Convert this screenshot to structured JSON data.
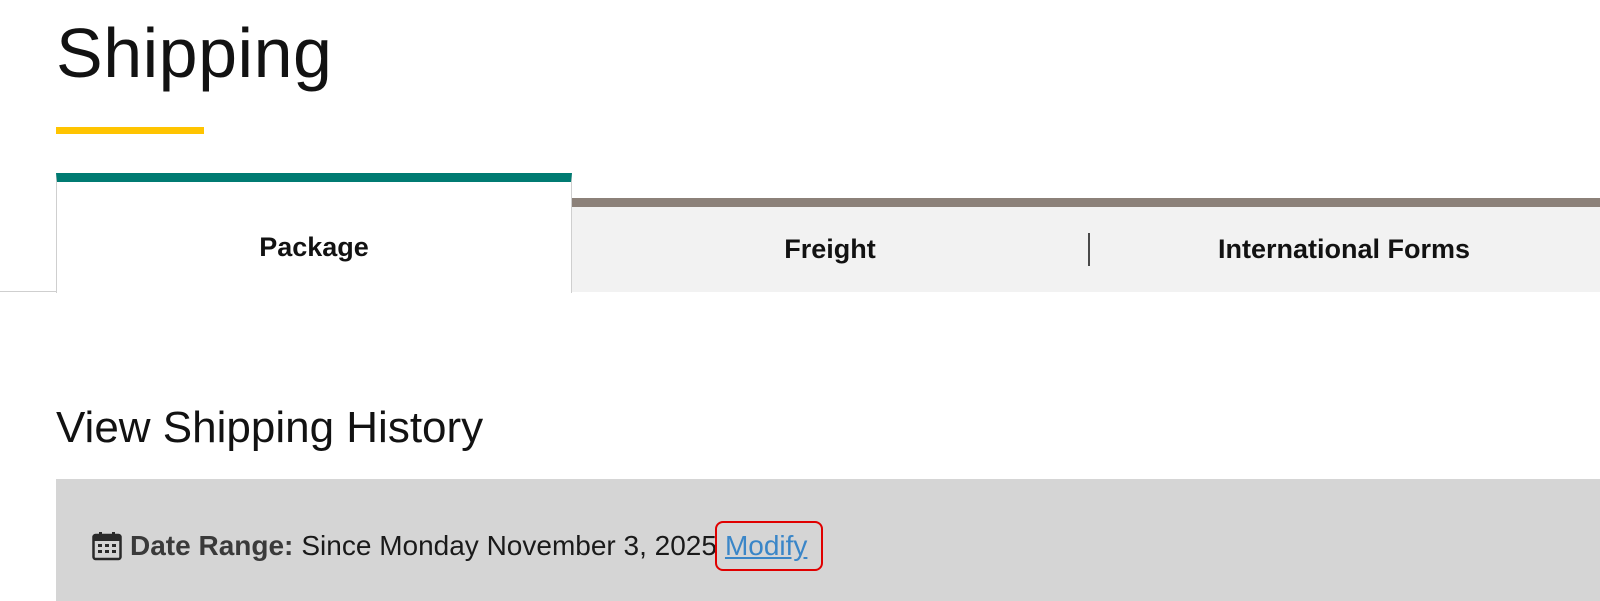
{
  "header": {
    "title": "Shipping"
  },
  "tabs": [
    {
      "label": "Package",
      "active": true
    },
    {
      "label": "Freight",
      "active": false
    },
    {
      "label": "International Forms",
      "active": false
    }
  ],
  "history": {
    "title": "View Shipping History",
    "date_range_label": "Date Range:",
    "date_range_value": "Since Monday November 3, 2025",
    "modify_link": "Modify",
    "icon": "calendar-icon"
  },
  "colors": {
    "title_accent": "#ffc400",
    "active_tab_accent": "#007b72",
    "inactive_tab_accent": "#8c8179",
    "link": "#3a86c8",
    "highlight": "#e00000",
    "panel_background": "#d5d5d5"
  }
}
